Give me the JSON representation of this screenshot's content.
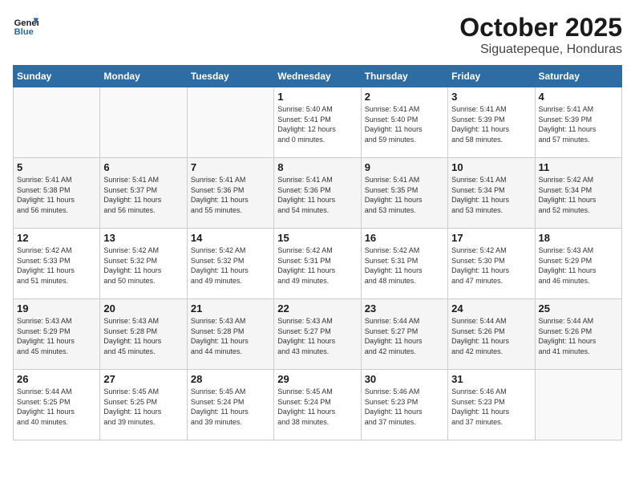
{
  "header": {
    "logo_line1": "General",
    "logo_line2": "Blue",
    "month": "October 2025",
    "location": "Siguatepeque, Honduras"
  },
  "weekdays": [
    "Sunday",
    "Monday",
    "Tuesday",
    "Wednesday",
    "Thursday",
    "Friday",
    "Saturday"
  ],
  "weeks": [
    [
      {
        "day": "",
        "info": ""
      },
      {
        "day": "",
        "info": ""
      },
      {
        "day": "",
        "info": ""
      },
      {
        "day": "1",
        "info": "Sunrise: 5:40 AM\nSunset: 5:41 PM\nDaylight: 12 hours\nand 0 minutes."
      },
      {
        "day": "2",
        "info": "Sunrise: 5:41 AM\nSunset: 5:40 PM\nDaylight: 11 hours\nand 59 minutes."
      },
      {
        "day": "3",
        "info": "Sunrise: 5:41 AM\nSunset: 5:39 PM\nDaylight: 11 hours\nand 58 minutes."
      },
      {
        "day": "4",
        "info": "Sunrise: 5:41 AM\nSunset: 5:39 PM\nDaylight: 11 hours\nand 57 minutes."
      }
    ],
    [
      {
        "day": "5",
        "info": "Sunrise: 5:41 AM\nSunset: 5:38 PM\nDaylight: 11 hours\nand 56 minutes."
      },
      {
        "day": "6",
        "info": "Sunrise: 5:41 AM\nSunset: 5:37 PM\nDaylight: 11 hours\nand 56 minutes."
      },
      {
        "day": "7",
        "info": "Sunrise: 5:41 AM\nSunset: 5:36 PM\nDaylight: 11 hours\nand 55 minutes."
      },
      {
        "day": "8",
        "info": "Sunrise: 5:41 AM\nSunset: 5:36 PM\nDaylight: 11 hours\nand 54 minutes."
      },
      {
        "day": "9",
        "info": "Sunrise: 5:41 AM\nSunset: 5:35 PM\nDaylight: 11 hours\nand 53 minutes."
      },
      {
        "day": "10",
        "info": "Sunrise: 5:41 AM\nSunset: 5:34 PM\nDaylight: 11 hours\nand 53 minutes."
      },
      {
        "day": "11",
        "info": "Sunrise: 5:42 AM\nSunset: 5:34 PM\nDaylight: 11 hours\nand 52 minutes."
      }
    ],
    [
      {
        "day": "12",
        "info": "Sunrise: 5:42 AM\nSunset: 5:33 PM\nDaylight: 11 hours\nand 51 minutes."
      },
      {
        "day": "13",
        "info": "Sunrise: 5:42 AM\nSunset: 5:32 PM\nDaylight: 11 hours\nand 50 minutes."
      },
      {
        "day": "14",
        "info": "Sunrise: 5:42 AM\nSunset: 5:32 PM\nDaylight: 11 hours\nand 49 minutes."
      },
      {
        "day": "15",
        "info": "Sunrise: 5:42 AM\nSunset: 5:31 PM\nDaylight: 11 hours\nand 49 minutes."
      },
      {
        "day": "16",
        "info": "Sunrise: 5:42 AM\nSunset: 5:31 PM\nDaylight: 11 hours\nand 48 minutes."
      },
      {
        "day": "17",
        "info": "Sunrise: 5:42 AM\nSunset: 5:30 PM\nDaylight: 11 hours\nand 47 minutes."
      },
      {
        "day": "18",
        "info": "Sunrise: 5:43 AM\nSunset: 5:29 PM\nDaylight: 11 hours\nand 46 minutes."
      }
    ],
    [
      {
        "day": "19",
        "info": "Sunrise: 5:43 AM\nSunset: 5:29 PM\nDaylight: 11 hours\nand 45 minutes."
      },
      {
        "day": "20",
        "info": "Sunrise: 5:43 AM\nSunset: 5:28 PM\nDaylight: 11 hours\nand 45 minutes."
      },
      {
        "day": "21",
        "info": "Sunrise: 5:43 AM\nSunset: 5:28 PM\nDaylight: 11 hours\nand 44 minutes."
      },
      {
        "day": "22",
        "info": "Sunrise: 5:43 AM\nSunset: 5:27 PM\nDaylight: 11 hours\nand 43 minutes."
      },
      {
        "day": "23",
        "info": "Sunrise: 5:44 AM\nSunset: 5:27 PM\nDaylight: 11 hours\nand 42 minutes."
      },
      {
        "day": "24",
        "info": "Sunrise: 5:44 AM\nSunset: 5:26 PM\nDaylight: 11 hours\nand 42 minutes."
      },
      {
        "day": "25",
        "info": "Sunrise: 5:44 AM\nSunset: 5:26 PM\nDaylight: 11 hours\nand 41 minutes."
      }
    ],
    [
      {
        "day": "26",
        "info": "Sunrise: 5:44 AM\nSunset: 5:25 PM\nDaylight: 11 hours\nand 40 minutes."
      },
      {
        "day": "27",
        "info": "Sunrise: 5:45 AM\nSunset: 5:25 PM\nDaylight: 11 hours\nand 39 minutes."
      },
      {
        "day": "28",
        "info": "Sunrise: 5:45 AM\nSunset: 5:24 PM\nDaylight: 11 hours\nand 39 minutes."
      },
      {
        "day": "29",
        "info": "Sunrise: 5:45 AM\nSunset: 5:24 PM\nDaylight: 11 hours\nand 38 minutes."
      },
      {
        "day": "30",
        "info": "Sunrise: 5:46 AM\nSunset: 5:23 PM\nDaylight: 11 hours\nand 37 minutes."
      },
      {
        "day": "31",
        "info": "Sunrise: 5:46 AM\nSunset: 5:23 PM\nDaylight: 11 hours\nand 37 minutes."
      },
      {
        "day": "",
        "info": ""
      }
    ]
  ]
}
